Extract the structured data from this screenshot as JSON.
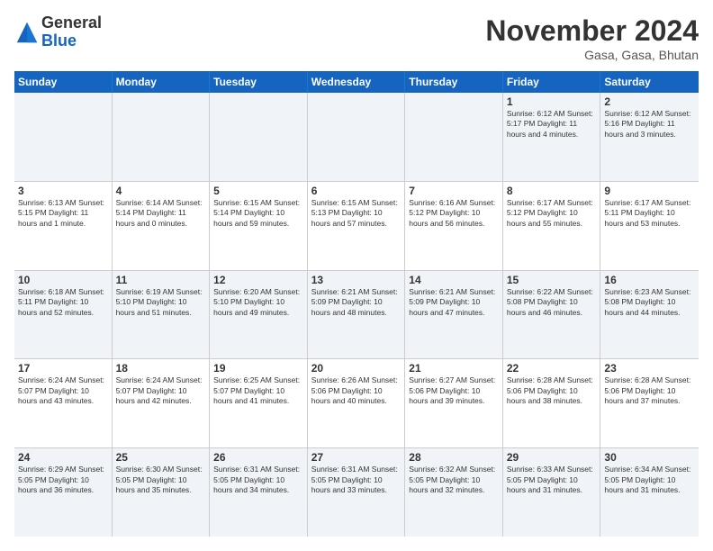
{
  "header": {
    "logo": {
      "general": "General",
      "blue": "Blue"
    },
    "title": "November 2024",
    "location": "Gasa, Gasa, Bhutan"
  },
  "calendar": {
    "days_of_week": [
      "Sunday",
      "Monday",
      "Tuesday",
      "Wednesday",
      "Thursday",
      "Friday",
      "Saturday"
    ],
    "rows": [
      [
        {
          "day": "",
          "info": ""
        },
        {
          "day": "",
          "info": ""
        },
        {
          "day": "",
          "info": ""
        },
        {
          "day": "",
          "info": ""
        },
        {
          "day": "",
          "info": ""
        },
        {
          "day": "1",
          "info": "Sunrise: 6:12 AM\nSunset: 5:17 PM\nDaylight: 11 hours and 4 minutes."
        },
        {
          "day": "2",
          "info": "Sunrise: 6:12 AM\nSunset: 5:16 PM\nDaylight: 11 hours and 3 minutes."
        }
      ],
      [
        {
          "day": "3",
          "info": "Sunrise: 6:13 AM\nSunset: 5:15 PM\nDaylight: 11 hours and 1 minute."
        },
        {
          "day": "4",
          "info": "Sunrise: 6:14 AM\nSunset: 5:14 PM\nDaylight: 11 hours and 0 minutes."
        },
        {
          "day": "5",
          "info": "Sunrise: 6:15 AM\nSunset: 5:14 PM\nDaylight: 10 hours and 59 minutes."
        },
        {
          "day": "6",
          "info": "Sunrise: 6:15 AM\nSunset: 5:13 PM\nDaylight: 10 hours and 57 minutes."
        },
        {
          "day": "7",
          "info": "Sunrise: 6:16 AM\nSunset: 5:12 PM\nDaylight: 10 hours and 56 minutes."
        },
        {
          "day": "8",
          "info": "Sunrise: 6:17 AM\nSunset: 5:12 PM\nDaylight: 10 hours and 55 minutes."
        },
        {
          "day": "9",
          "info": "Sunrise: 6:17 AM\nSunset: 5:11 PM\nDaylight: 10 hours and 53 minutes."
        }
      ],
      [
        {
          "day": "10",
          "info": "Sunrise: 6:18 AM\nSunset: 5:11 PM\nDaylight: 10 hours and 52 minutes."
        },
        {
          "day": "11",
          "info": "Sunrise: 6:19 AM\nSunset: 5:10 PM\nDaylight: 10 hours and 51 minutes."
        },
        {
          "day": "12",
          "info": "Sunrise: 6:20 AM\nSunset: 5:10 PM\nDaylight: 10 hours and 49 minutes."
        },
        {
          "day": "13",
          "info": "Sunrise: 6:21 AM\nSunset: 5:09 PM\nDaylight: 10 hours and 48 minutes."
        },
        {
          "day": "14",
          "info": "Sunrise: 6:21 AM\nSunset: 5:09 PM\nDaylight: 10 hours and 47 minutes."
        },
        {
          "day": "15",
          "info": "Sunrise: 6:22 AM\nSunset: 5:08 PM\nDaylight: 10 hours and 46 minutes."
        },
        {
          "day": "16",
          "info": "Sunrise: 6:23 AM\nSunset: 5:08 PM\nDaylight: 10 hours and 44 minutes."
        }
      ],
      [
        {
          "day": "17",
          "info": "Sunrise: 6:24 AM\nSunset: 5:07 PM\nDaylight: 10 hours and 43 minutes."
        },
        {
          "day": "18",
          "info": "Sunrise: 6:24 AM\nSunset: 5:07 PM\nDaylight: 10 hours and 42 minutes."
        },
        {
          "day": "19",
          "info": "Sunrise: 6:25 AM\nSunset: 5:07 PM\nDaylight: 10 hours and 41 minutes."
        },
        {
          "day": "20",
          "info": "Sunrise: 6:26 AM\nSunset: 5:06 PM\nDaylight: 10 hours and 40 minutes."
        },
        {
          "day": "21",
          "info": "Sunrise: 6:27 AM\nSunset: 5:06 PM\nDaylight: 10 hours and 39 minutes."
        },
        {
          "day": "22",
          "info": "Sunrise: 6:28 AM\nSunset: 5:06 PM\nDaylight: 10 hours and 38 minutes."
        },
        {
          "day": "23",
          "info": "Sunrise: 6:28 AM\nSunset: 5:06 PM\nDaylight: 10 hours and 37 minutes."
        }
      ],
      [
        {
          "day": "24",
          "info": "Sunrise: 6:29 AM\nSunset: 5:05 PM\nDaylight: 10 hours and 36 minutes."
        },
        {
          "day": "25",
          "info": "Sunrise: 6:30 AM\nSunset: 5:05 PM\nDaylight: 10 hours and 35 minutes."
        },
        {
          "day": "26",
          "info": "Sunrise: 6:31 AM\nSunset: 5:05 PM\nDaylight: 10 hours and 34 minutes."
        },
        {
          "day": "27",
          "info": "Sunrise: 6:31 AM\nSunset: 5:05 PM\nDaylight: 10 hours and 33 minutes."
        },
        {
          "day": "28",
          "info": "Sunrise: 6:32 AM\nSunset: 5:05 PM\nDaylight: 10 hours and 32 minutes."
        },
        {
          "day": "29",
          "info": "Sunrise: 6:33 AM\nSunset: 5:05 PM\nDaylight: 10 hours and 31 minutes."
        },
        {
          "day": "30",
          "info": "Sunrise: 6:34 AM\nSunset: 5:05 PM\nDaylight: 10 hours and 31 minutes."
        }
      ]
    ]
  }
}
